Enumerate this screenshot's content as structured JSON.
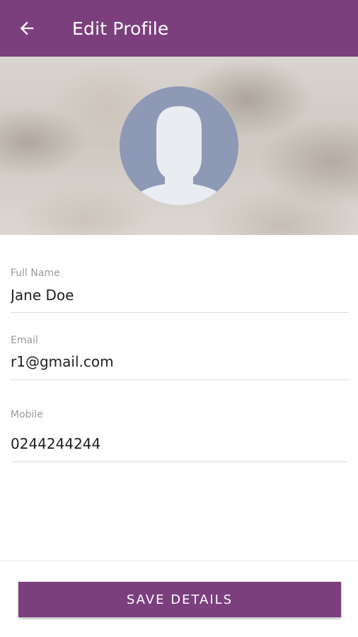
{
  "app_bar": {
    "title": "Edit Profile",
    "back_icon": "arrow-left-icon",
    "color": "#7b3f7e"
  },
  "profile": {
    "avatar_icon": "default-user-avatar-icon"
  },
  "form": {
    "full_name": {
      "label": "Full Name",
      "value": "Jane Doe"
    },
    "email": {
      "label": "Email",
      "value": "r1@gmail.com"
    },
    "mobile": {
      "label": "Mobile",
      "value": "0244244244"
    }
  },
  "actions": {
    "save_label": "SAVE DETAILS"
  }
}
